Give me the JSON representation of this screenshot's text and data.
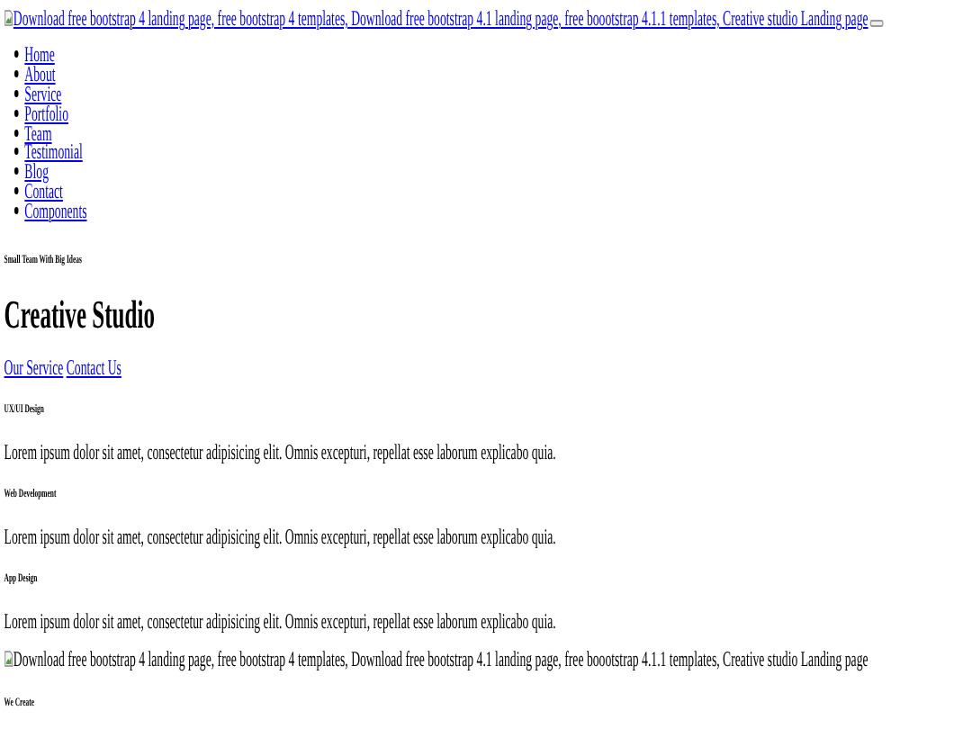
{
  "header": {
    "logo_alt": "Download free bootstrap 4 landing page, free bootstrap 4 templates, Download free bootstrap 4.1 landing page, free boootstrap 4.1.1 templates, Creative studio Landing page"
  },
  "nav": [
    "Home",
    "About",
    "Service",
    "Portfolio",
    "Team",
    "Testimonial",
    "Blog",
    "Contact",
    "Components"
  ],
  "hero": {
    "tagline": "Small Team With Big Ideas",
    "title": "Creative Studio",
    "links": [
      "Our Service",
      "Contact Us"
    ]
  },
  "services": [
    {
      "title": "UX/UI Design",
      "text": "Lorem ipsum dolor sit amet, consectetur adipisicing elit. Omnis excepturi, repellat esse laborum explicabo quia."
    },
    {
      "title": "Web Development",
      "text": "Lorem ipsum dolor sit amet, consectetur adipisicing elit. Omnis excepturi, repellat esse laborum explicabo quia."
    },
    {
      "title": "App Design",
      "text": "Lorem ipsum dolor sit amet, consectetur adipisicing elit. Omnis excepturi, repellat esse laborum explicabo quia."
    }
  ],
  "image_alt": "Download free bootstrap 4 landing page, free bootstrap 4 templates, Download free bootstrap 4.1 landing page, free boootstrap 4.1.1 templates, Creative studio Landing page",
  "section": {
    "heading": "We Create"
  }
}
